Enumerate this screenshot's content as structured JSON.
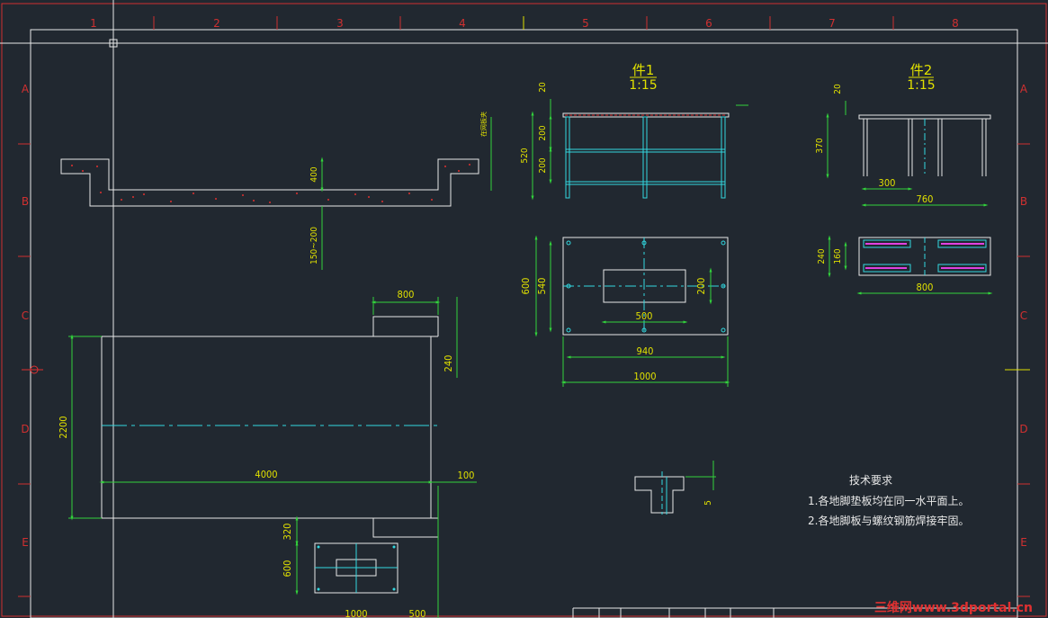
{
  "watermark": "三维网www.3dportal.cn",
  "colors": {
    "background": "#212830",
    "sheet_border": "#e8e8e8",
    "outer_border": "#d03030",
    "object_line": "#e8e8e8",
    "dimension": "#32d23c",
    "dimension_text": "#e0e000",
    "center_line": "#32d8e0",
    "hatch": "#e03030",
    "grid_label": "#e03030",
    "magenta": "#e040e0",
    "watermark": "#e03030"
  },
  "grid": {
    "columns": [
      "1",
      "2",
      "3",
      "4",
      "5",
      "6",
      "7",
      "8"
    ],
    "rows": [
      "A",
      "B",
      "C",
      "D",
      "E"
    ]
  },
  "part1": {
    "title": "件1",
    "scale": "1:15",
    "elevation_dims": [
      "20",
      "200",
      "200",
      "520"
    ],
    "plan_dims": [
      "600",
      "540",
      "200",
      "500",
      "940",
      "1000"
    ]
  },
  "part2": {
    "title": "件2",
    "scale": "1:15",
    "elevation_dims": [
      "20",
      "370",
      "300",
      "760"
    ],
    "plan_dims": [
      "240",
      "160",
      "800"
    ]
  },
  "section": {
    "dims": [
      "400",
      "150~200"
    ],
    "note": "在网板夹"
  },
  "plan": {
    "dims": [
      "800",
      "240",
      "2200",
      "4000",
      "100",
      "320",
      "600",
      "1000",
      "500"
    ]
  },
  "detail": {
    "dims": [
      "5"
    ]
  },
  "tech_requirements": {
    "title": "技术要求",
    "items": [
      "1.各地脚垫板均在同一水平面上。",
      "2.各地脚板与螺纹钢筋焊接牢固。"
    ]
  }
}
